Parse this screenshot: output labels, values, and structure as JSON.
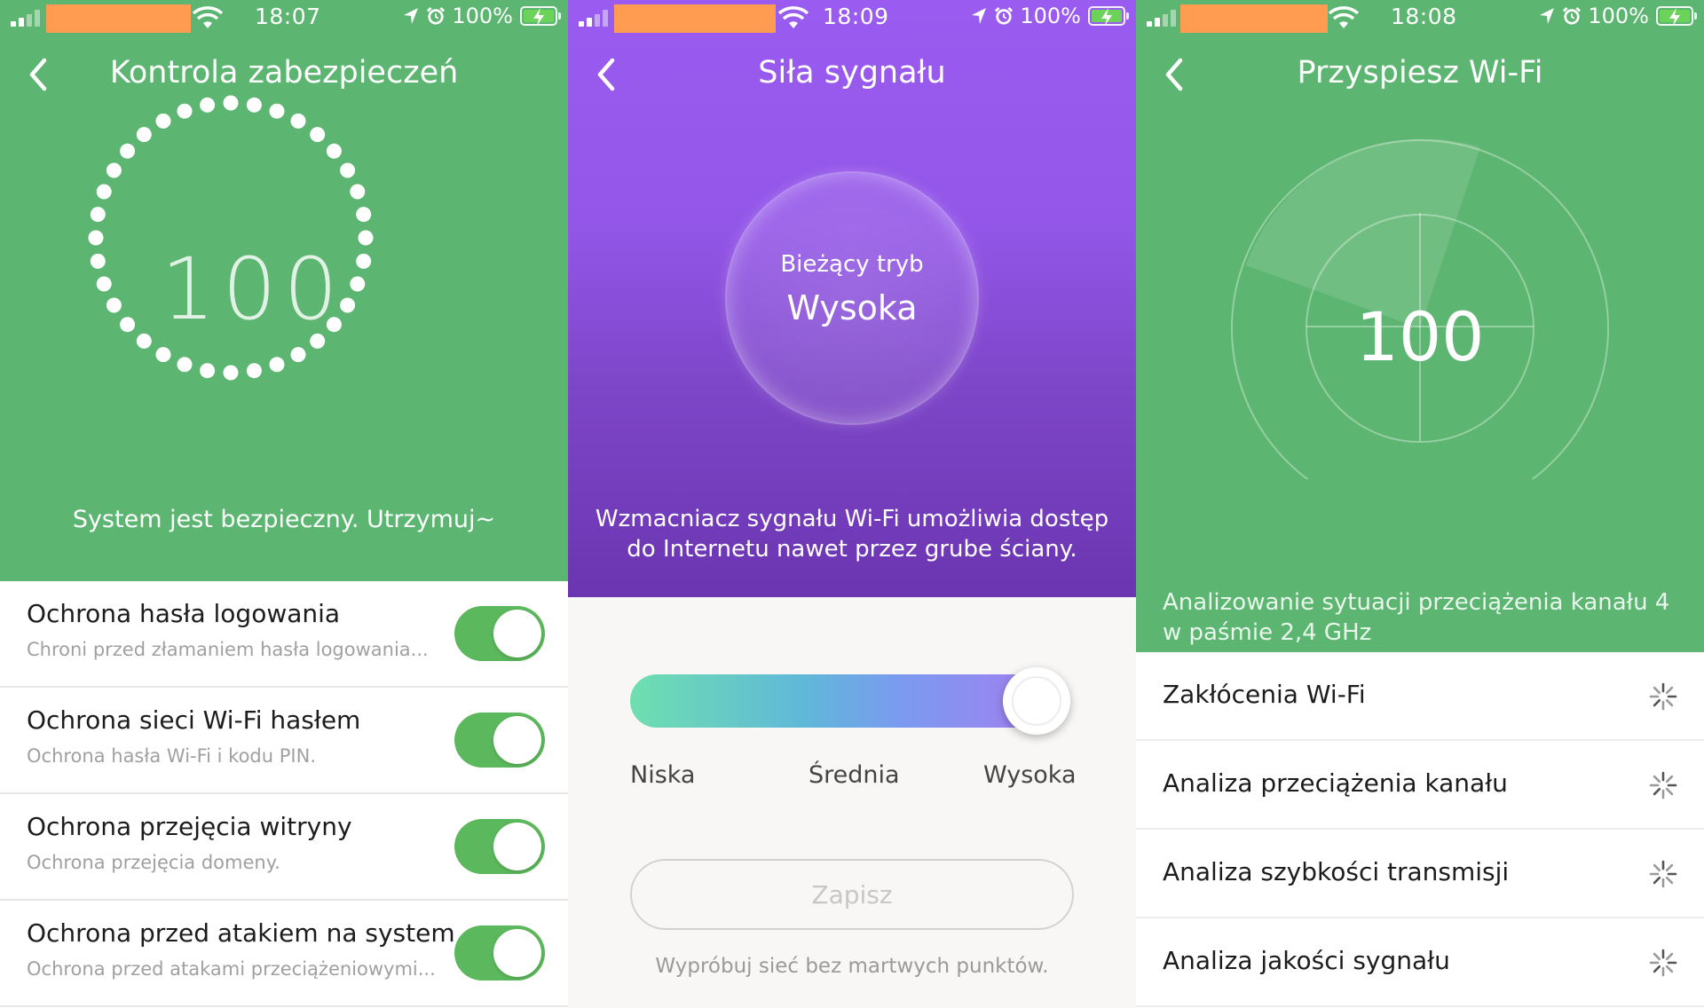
{
  "screens": [
    {
      "status": {
        "time": "18:07",
        "battery": "100%"
      },
      "title": "Kontrola zabezpieczeń",
      "score": "100",
      "status_message": "System jest bezpieczny. Utrzymuj~",
      "items": [
        {
          "title": "Ochrona hasła logowania",
          "subtitle": "Chroni przed złamaniem hasła logowania...",
          "enabled": true
        },
        {
          "title": "Ochrona sieci Wi-Fi hasłem",
          "subtitle": "Ochrona hasła Wi-Fi i kodu PIN.",
          "enabled": true
        },
        {
          "title": "Ochrona przejęcia witryny",
          "subtitle": "Ochrona przejęcia domeny.",
          "enabled": true
        },
        {
          "title": "Ochrona przed atakiem na system",
          "subtitle": "Ochrona przed atakami przeciążeniowymi...",
          "enabled": true
        }
      ],
      "colors": {
        "hero": "#5cb570",
        "toggle_on": "#5cb85c"
      }
    },
    {
      "status": {
        "time": "18:09",
        "battery": "100%"
      },
      "title": "Siła sygnału",
      "current_mode_caption": "Bieżący tryb",
      "current_mode_value": "Wysoka",
      "description": "Wzmacniacz sygnału Wi-Fi umożliwia dostęp do Internetu nawet przez grube ściany.",
      "slider": {
        "labels": [
          "Niska",
          "Średnia",
          "Wysoka"
        ],
        "selected": "Wysoka",
        "position": 1.0
      },
      "save_label": "Zapisz",
      "hint": "Wypróbuj sieć bez martwych punktów.",
      "colors": {
        "hero_top": "#9a5cf0",
        "hero_bottom": "#6b35b1"
      }
    },
    {
      "status": {
        "time": "18:08",
        "battery": "100%"
      },
      "title": "Przyspiesz Wi-Fi",
      "score": "100",
      "analyzing_text": "Analizowanie sytuacji przeciążenia kanału 4 w paśmie 2,4 GHz",
      "checks": [
        {
          "label": "Zakłócenia Wi-Fi",
          "state": "loading"
        },
        {
          "label": "Analiza przeciążenia kanału",
          "state": "loading"
        },
        {
          "label": "Analiza szybkości transmisji",
          "state": "loading"
        },
        {
          "label": "Analiza jakości sygnału",
          "state": "loading"
        }
      ],
      "colors": {
        "hero": "#5cb570"
      }
    }
  ],
  "icons": [
    "back-chevron-icon",
    "wifi-icon",
    "location-icon",
    "alarm-icon",
    "battery-charging-icon",
    "spinner-icon"
  ]
}
